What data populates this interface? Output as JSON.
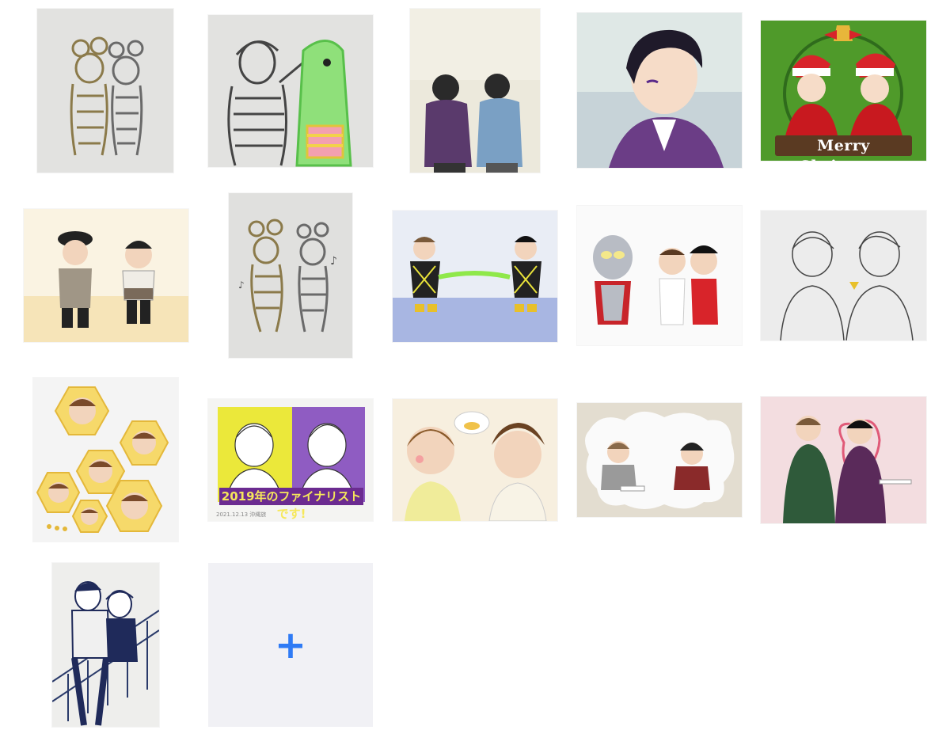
{
  "gallery": {
    "tiles": [
      {
        "label": "",
        "scene": "mouse-costume-pencil-sketch"
      },
      {
        "label": "",
        "scene": "green-mascot-sketch"
      },
      {
        "label": "",
        "scene": "two-people-walking-street"
      },
      {
        "label": "",
        "scene": "portrait-purple-jacket"
      },
      {
        "label": "Merry Christmas",
        "scene": "santa-hats-duo"
      },
      {
        "label": "",
        "scene": "chibi-duo-hat"
      },
      {
        "label": "",
        "scene": "mouse-ears-dancing-sketch"
      },
      {
        "label": "",
        "scene": "tug-of-war-rope"
      },
      {
        "label": "",
        "scene": "ultraman-and-duo"
      },
      {
        "label": "",
        "scene": "lineart-duo"
      },
      {
        "label": "",
        "scene": "hexagon-heads-collage"
      },
      {
        "label": "2019年のファイナリストです!",
        "scene": "finalist-portraits",
        "caption": "2021.12.13 沖縄旅"
      },
      {
        "label": "",
        "scene": "food-thought-bubble"
      },
      {
        "label": "",
        "scene": "thought-cloud-desk"
      },
      {
        "label": "",
        "scene": "heart-suits-duo"
      },
      {
        "label": "",
        "scene": "stairs-blue-ink"
      }
    ],
    "add_button": {
      "symbol": "+",
      "icon": "plus-icon",
      "color": "#2f7bf5"
    }
  },
  "colors": {
    "background": "#ffffff",
    "add_tile": "#f1f1f5",
    "accent": "#2f7bf5"
  }
}
